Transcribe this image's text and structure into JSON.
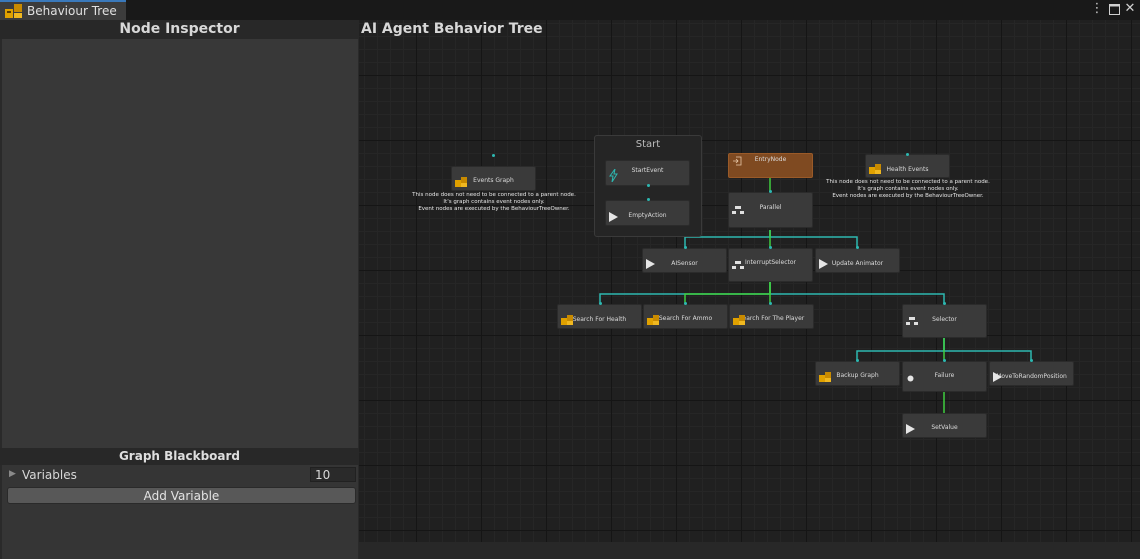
{
  "window": {
    "tab_title": "Behaviour Tree",
    "menu_icon": "vertical-dots-icon",
    "maximize_icon": "maximize-icon",
    "close_icon": "close-icon"
  },
  "inspector": {
    "title": "Node Inspector"
  },
  "blackboard": {
    "title": "Graph Blackboard",
    "variables_label": "Variables",
    "variables_count": "10",
    "add_variable_label": "Add Variable"
  },
  "graph": {
    "title": "AI Agent Behavior Tree",
    "group_start_title": "Start",
    "nodes": {
      "start_event": "StartEvent",
      "empty_action": "EmptyAction",
      "entry_node": "EntryNode",
      "parallel": "Parallel",
      "events_graph": "Events Graph",
      "health_events": "Health Events",
      "ai_sensor": "AISensor",
      "interrupt_selector": "InterruptSelector",
      "update_animator": "Update Animator",
      "search_health": "Search For Health",
      "search_ammo": "Search For Ammo",
      "search_player": "Search For The Player",
      "selector": "Selector",
      "backup_graph": "Backup Graph",
      "failure": "Failure",
      "move_random": "MoveToRandomPosition",
      "set_value": "SetValue"
    },
    "comment_events_graph": [
      "This node does not need to be connected to a parent node.",
      "It's graph contains event nodes only.",
      "Event nodes are executed by the BehaviourTreeOwner."
    ],
    "comment_health_events": [
      "This node does not need to be connected to a parent node.",
      "It's graph contains event nodes only.",
      "Event nodes are executed by the BehaviourTreeOwner."
    ]
  },
  "colors": {
    "accent_tab": "#3a79bb",
    "wire_teal": "#2db7b0",
    "wire_green": "#3fce3f",
    "entry_node": "#7f4a21"
  }
}
